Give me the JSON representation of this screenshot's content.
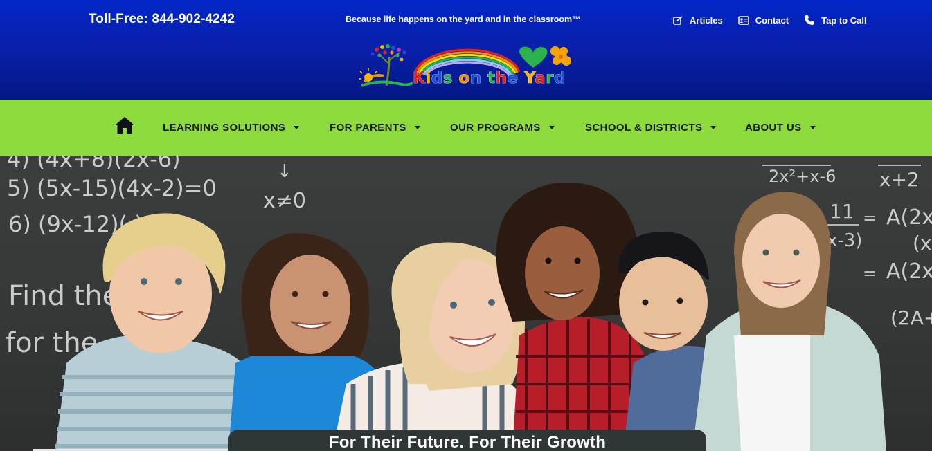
{
  "header": {
    "toll_free": "Toll-Free: 844-902-4242",
    "tagline": "Because life happens on the yard and in the classroom™",
    "links": [
      {
        "label": "Articles",
        "icon": "articles-icon"
      },
      {
        "label": "Contact",
        "icon": "contact-card-icon"
      },
      {
        "label": "Tap to Call",
        "icon": "phone-icon"
      }
    ]
  },
  "logo": {
    "letters": [
      "K",
      "i",
      "d",
      "s",
      " ",
      "o",
      "n",
      " ",
      "t",
      "h",
      "e",
      " ",
      "Y",
      "a",
      "r",
      "d"
    ],
    "display_text": "Kids on the Yard",
    "colors": {
      "red": "#e2231a",
      "yellow": "#f7b500",
      "blue": "#1d4fd8",
      "green": "#2bb24c",
      "orange": "#f39200"
    }
  },
  "nav": {
    "home_icon": "home-icon",
    "items": [
      {
        "label": "LEARNING SOLUTIONS"
      },
      {
        "label": "FOR PARENTS"
      },
      {
        "label": "OUR PROGRAMS"
      },
      {
        "label": "SCHOOL & DISTRICTS"
      },
      {
        "label": "ABOUT US"
      }
    ]
  },
  "hero": {
    "title": "For Their Future. For Their Growth",
    "image_alt": "kids-and-teacher-photo",
    "chalk_lines": [
      "4) (4x+8)(2x-6)",
      "5) (5x-15)(4x-2)=0",
      "6) (9x-12)(   )=0",
      "x≠0",
      "Find the",
      "for the",
      "2x²+x-6",
      "x+2",
      "11",
      "x-3)",
      "A(2x",
      "(x",
      "A(2x",
      "(2A+"
    ]
  },
  "colors": {
    "header_top": "#0226c8",
    "header_bottom": "#031784",
    "nav_bg": "#8edb3d",
    "hero_banner": "#2f3637"
  }
}
